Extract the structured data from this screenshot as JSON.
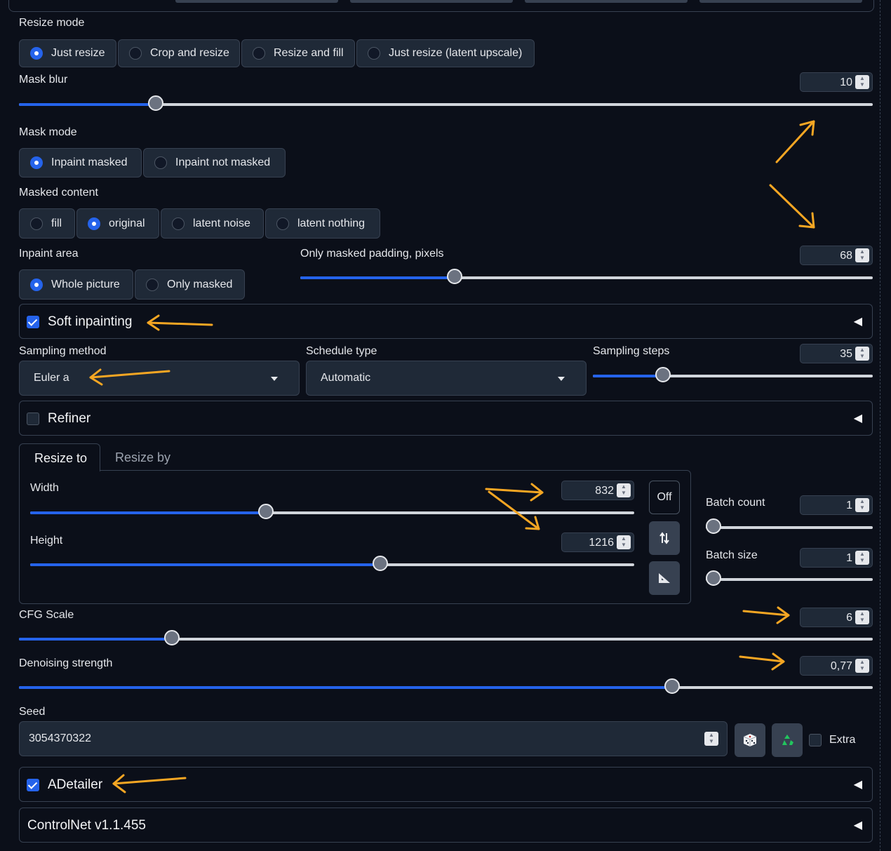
{
  "resize_mode": {
    "label": "Resize mode",
    "options": [
      "Just resize",
      "Crop and resize",
      "Resize and fill",
      "Just resize (latent upscale)"
    ],
    "selected": "Just resize"
  },
  "mask_blur": {
    "label": "Mask blur",
    "value": "10",
    "fraction": 0.16
  },
  "mask_mode": {
    "label": "Mask mode",
    "options": [
      "Inpaint masked",
      "Inpaint not masked"
    ],
    "selected": "Inpaint masked"
  },
  "masked_content": {
    "label": "Masked content",
    "options": [
      "fill",
      "original",
      "latent noise",
      "latent nothing"
    ],
    "selected": "original"
  },
  "inpaint_area": {
    "label": "Inpaint area",
    "options": [
      "Whole picture",
      "Only masked"
    ],
    "selected": "Whole picture"
  },
  "only_masked_padding": {
    "label": "Only masked padding, pixels",
    "value": "68",
    "fraction": 0.27
  },
  "soft_inpainting": {
    "label": "Soft inpainting",
    "checked": true
  },
  "sampling_method": {
    "label": "Sampling method",
    "value": "Euler a"
  },
  "schedule_type": {
    "label": "Schedule type",
    "value": "Automatic"
  },
  "sampling_steps": {
    "label": "Sampling steps",
    "value": "35",
    "fraction": 0.25
  },
  "refiner": {
    "label": "Refiner",
    "checked": false
  },
  "resize_tabs": {
    "tabs": [
      "Resize to",
      "Resize by"
    ],
    "active": "Resize to"
  },
  "width": {
    "label": "Width",
    "value": "832",
    "fraction": 0.39
  },
  "height": {
    "label": "Height",
    "value": "1216",
    "fraction": 0.58
  },
  "dim_buttons": {
    "off_label": "Off"
  },
  "batch_count": {
    "label": "Batch count",
    "value": "1",
    "fraction": 0.0
  },
  "batch_size": {
    "label": "Batch size",
    "value": "1",
    "fraction": 0.0
  },
  "cfg_scale": {
    "label": "CFG Scale",
    "value": "6",
    "fraction": 0.179
  },
  "denoising_strength": {
    "label": "Denoising strength",
    "value": "0,77",
    "fraction": 0.765
  },
  "seed": {
    "label": "Seed",
    "value": "3054370322",
    "extra_label": "Extra"
  },
  "adetailer": {
    "label": "ADetailer",
    "checked": true
  },
  "controlnet": {
    "label": "ControlNet v1.1.455"
  },
  "colors": {
    "accent": "#2563eb",
    "annotation": "#f5a623",
    "background": "#0b0f19"
  },
  "icons": {
    "swap": "swap-arrows-icon",
    "aspect": "set-square-icon",
    "random": "dice-icon",
    "reuse": "recycle-icon",
    "collapse": "triangle-left-icon"
  }
}
